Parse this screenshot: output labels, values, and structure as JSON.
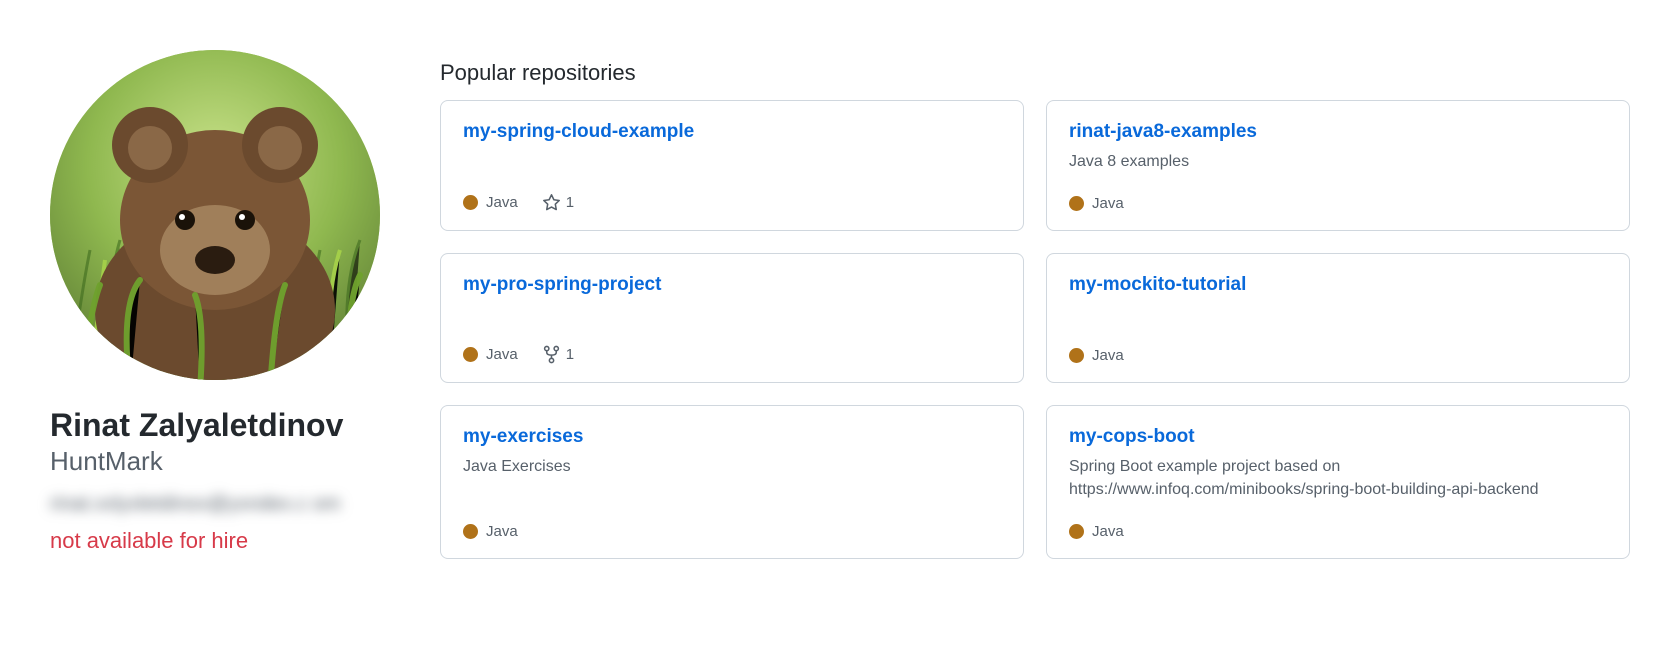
{
  "profile": {
    "full_name": "Rinat Zalyaletdinov",
    "username": "HuntMark",
    "email_obscured": "rinat.xxlyxletdinov@yxndex.c om",
    "hire_status": "not available for hire"
  },
  "section_title": "Popular repositories",
  "language_color": "#b07219",
  "repos": [
    {
      "name": "my-spring-cloud-example",
      "description": "",
      "language": "Java",
      "stars": "1",
      "forks": ""
    },
    {
      "name": "rinat-java8-examples",
      "description": "Java 8 examples",
      "language": "Java",
      "stars": "",
      "forks": ""
    },
    {
      "name": "my-pro-spring-project",
      "description": "",
      "language": "Java",
      "stars": "",
      "forks": "1"
    },
    {
      "name": "my-mockito-tutorial",
      "description": "",
      "language": "Java",
      "stars": "",
      "forks": ""
    },
    {
      "name": "my-exercises",
      "description": "Java Exercises",
      "language": "Java",
      "stars": "",
      "forks": ""
    },
    {
      "name": "my-cops-boot",
      "description": "Spring Boot example project based on https://www.infoq.com/minibooks/spring-boot-building-api-backend",
      "language": "Java",
      "stars": "",
      "forks": ""
    }
  ]
}
